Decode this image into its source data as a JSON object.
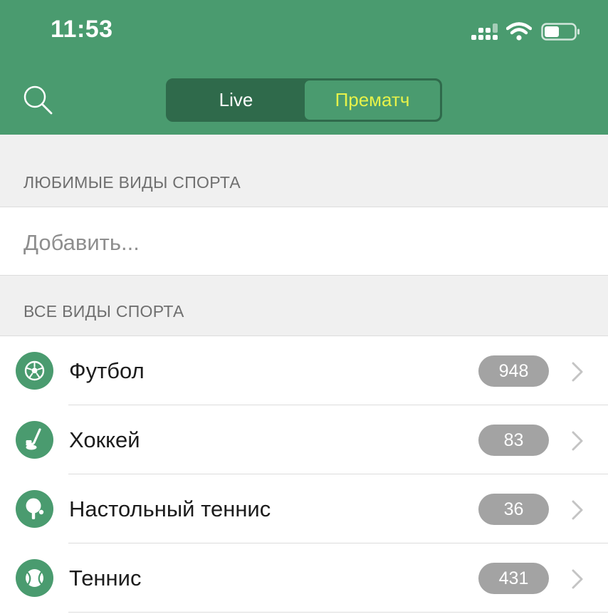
{
  "status_bar": {
    "time": "11:53"
  },
  "header": {
    "search_icon": "search-icon",
    "segments": {
      "live": "Live",
      "prematch": "Прематч",
      "selected": "prematch"
    }
  },
  "favorites": {
    "title": "ЛЮБИМЫЕ ВИДЫ СПОРТА",
    "add_label": "Добавить..."
  },
  "all_sports": {
    "title": "ВСЕ ВИДЫ СПОРТА",
    "items": [
      {
        "name": "Футбол",
        "count": "948",
        "icon": "soccer-ball-icon"
      },
      {
        "name": "Хоккей",
        "count": "83",
        "icon": "hockey-stick-icon"
      },
      {
        "name": "Настольный теннис",
        "count": "36",
        "icon": "ping-pong-icon"
      },
      {
        "name": "Теннис",
        "count": "431",
        "icon": "tennis-ball-icon"
      }
    ]
  },
  "colors": {
    "header_green": "#4a9b6f",
    "segment_dark": "#2f6a4b",
    "prematch_text": "#e6f24a",
    "badge_gray": "#a3a3a3"
  }
}
